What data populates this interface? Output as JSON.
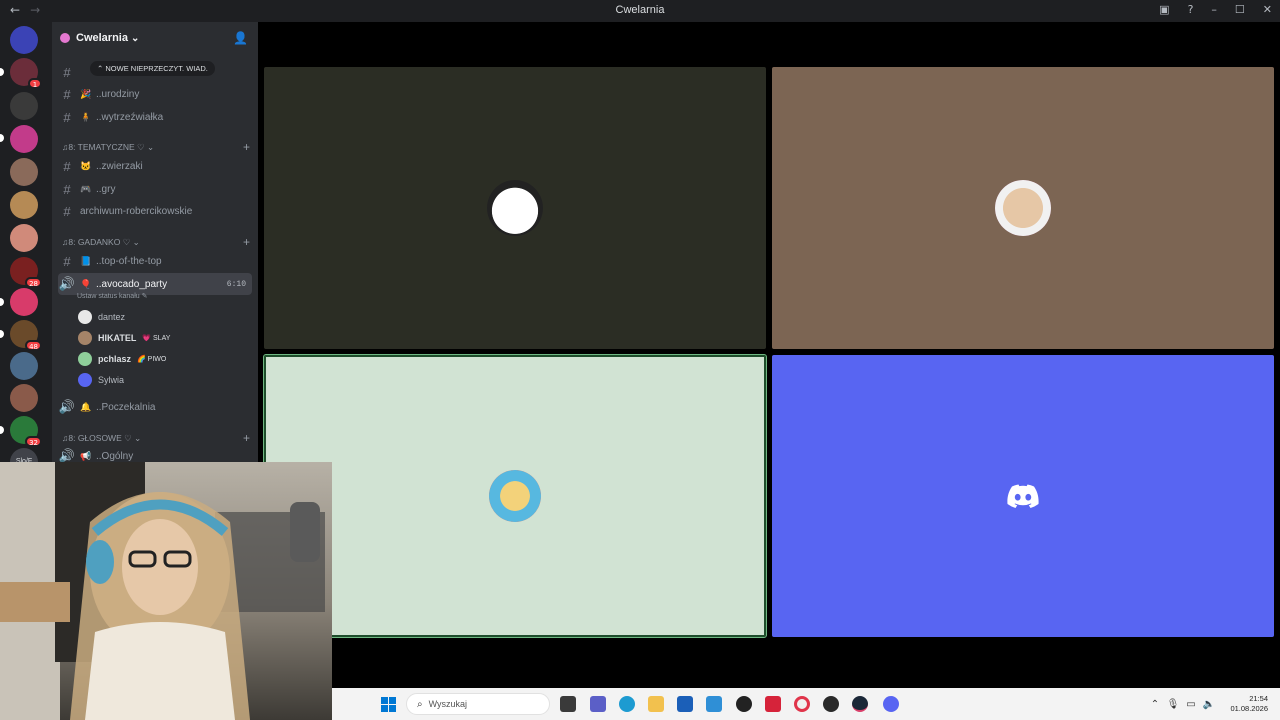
{
  "titlebar": {
    "back": "←",
    "forward": "→",
    "title": "Cwelarnia",
    "icons": [
      "inbox-icon",
      "help-icon",
      "minimize-icon",
      "maximize-icon",
      "close-icon"
    ]
  },
  "guild": {
    "name": "Cwelarnia",
    "chevron": "⌄",
    "new_unread": "⌃ NOWE NIEPRZECZYT. WIAD."
  },
  "channels": {
    "urodziny": "..urodziny",
    "wytrzezwialka": "..wytrzeźwiałka",
    "cat_tematyczne": "♫8: TEMATYCZNE ♡ ⌄",
    "zwierzaki": "..zwierzaki",
    "gry": "..gry",
    "archiwum": "archiwum-robercikowskie",
    "cat_gadanko": "♫8: GADANKO ♡ ⌄",
    "top": "..top-of-the-top",
    "avocado": "..avocado_party",
    "avocado_time": "6:10",
    "status": "Ustaw status kanału ✎",
    "poczekalnia": "..Poczekalnia",
    "cat_glosowe": "♫8: GŁOSOWE ♡ ⌄",
    "ogolny": "..Ogólny"
  },
  "voice_users": [
    {
      "name": "dantez",
      "tag": ""
    },
    {
      "name": "HIKATEL",
      "tag": "💗 SLAY"
    },
    {
      "name": "pchlasz",
      "tag": "🌈 PIWO"
    },
    {
      "name": "Sylwia",
      "tag": ""
    }
  ],
  "server_badges": [
    "1",
    "28",
    "48",
    "32"
  ],
  "server_label": "Slo/F",
  "taskbar": {
    "search_placeholder": "Wyszukaj",
    "time": "21:54",
    "date": "01.08.2026",
    "apps": [
      "file-explorer-icon",
      "teams-icon",
      "edge-icon",
      "folder-icon",
      "store-icon",
      "outlook-icon",
      "github-icon",
      "app-red-icon",
      "opera-icon",
      "obs-icon",
      "steam-icon",
      "discord-icon"
    ]
  },
  "colors": {
    "accent": "#5865f2",
    "sidebar": "#2b2d31",
    "rail": "#1e1f22"
  }
}
